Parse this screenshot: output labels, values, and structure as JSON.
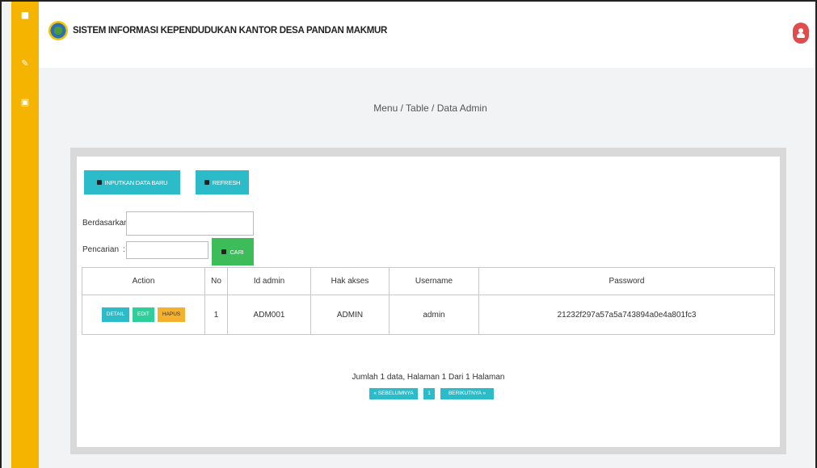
{
  "header": {
    "title": "SISTEM INFORMASI KEPENDUDUKAN KANTOR DESA PANDAN MAKMUR"
  },
  "sidebar": {
    "icons": [
      "home-icon",
      "edit-icon",
      "gift-icon"
    ]
  },
  "breadcrumb": "Menu / Table / Data Admin",
  "toolbar": {
    "add_label": "INPUTKAN DATA BARU",
    "refresh_label": "REFRESH"
  },
  "search": {
    "by_label": "Berdasarkan:",
    "by_value": "",
    "query_label": "Pencarian",
    "query_value": "",
    "search_button": "CARI"
  },
  "table": {
    "headers": [
      "Action",
      "No",
      "Id admin",
      "Hak akses",
      "Username",
      "Password"
    ],
    "rows": [
      {
        "actions": [
          "DETAIL",
          "EDIT",
          "HAPUS"
        ],
        "no": "1",
        "id_admin": "ADM001",
        "hak_akses": "ADMIN",
        "username": "admin",
        "password": "21232f297a57a5a743894a0e4a801fc3"
      }
    ]
  },
  "pagination": {
    "info": "Jumlah 1 data, Halaman 1 Dari 1 Halaman",
    "prev": "« SEBELUMNYA",
    "current": "1",
    "next": "BERIKUTNYA »"
  },
  "colors": {
    "sidebar": "#f4b400",
    "teal": "#2bbbc9",
    "green": "#3dbd5a",
    "user_button": "#e04b4b"
  }
}
